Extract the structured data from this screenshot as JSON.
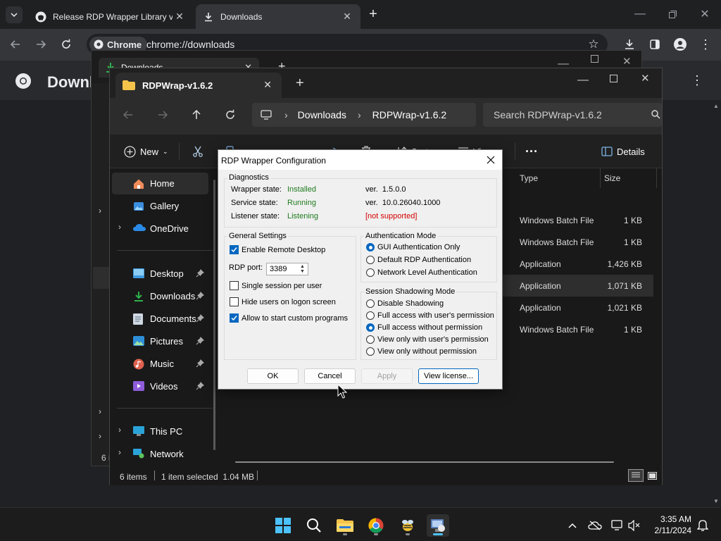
{
  "chrome": {
    "tabs": [
      {
        "title": "Release RDP Wrapper Library v",
        "icon": "github-icon"
      },
      {
        "title": "Downloads",
        "icon": "download-icon"
      }
    ],
    "url_chip": "Chrome",
    "url": "chrome://downloads",
    "page_title": "Downl"
  },
  "bg_explorer": {
    "tab_title": "Downloads",
    "status_partial": "6 i"
  },
  "explorer": {
    "tab_title": "RDPWrap-v1.6.2",
    "breadcrumb": [
      "Downloads",
      "RDPWrap-v1.6.2"
    ],
    "search_placeholder": "Search RDPWrap-v1.6.2",
    "commands": {
      "new": "New",
      "sort": "Sort",
      "view": "View",
      "details": "Details"
    },
    "sidebar": [
      {
        "label": "Home",
        "icon": "home-icon"
      },
      {
        "label": "Gallery",
        "icon": "gallery-icon"
      },
      {
        "label": "OneDrive",
        "icon": "onedrive-icon"
      },
      {
        "label": "Desktop",
        "icon": "desktop-icon"
      },
      {
        "label": "Downloads",
        "icon": "download-icon"
      },
      {
        "label": "Documents",
        "icon": "documents-icon"
      },
      {
        "label": "Pictures",
        "icon": "pictures-icon"
      },
      {
        "label": "Music",
        "icon": "music-icon"
      },
      {
        "label": "Videos",
        "icon": "videos-icon"
      },
      {
        "label": "This PC",
        "icon": "computer-icon"
      },
      {
        "label": "Network",
        "icon": "network-icon"
      }
    ],
    "columns": {
      "type": "Type",
      "size": "Size"
    },
    "rows": [
      {
        "type": "Windows Batch File",
        "size": "1 KB"
      },
      {
        "type": "Windows Batch File",
        "size": "1 KB"
      },
      {
        "type": "Application",
        "size": "1,426 KB"
      },
      {
        "type": "Application",
        "size": "1,071 KB"
      },
      {
        "type": "Application",
        "size": "1,021 KB"
      },
      {
        "type": "Windows Batch File",
        "size": "1 KB"
      }
    ],
    "status": {
      "items": "6 items",
      "selected": "1 item selected  1.04 MB"
    }
  },
  "dialog": {
    "title": "RDP Wrapper Configuration",
    "diagnostics": {
      "label": "Diagnostics",
      "wrapper_label": "Wrapper state:",
      "wrapper_value": "Installed",
      "wrapper_ver": "ver.  1.5.0.0",
      "service_label": "Service state:",
      "service_value": "Running",
      "service_ver": "ver.  10.0.26040.1000",
      "listener_label": "Listener state:",
      "listener_value": "Listening",
      "listener_ver": "[not supported]"
    },
    "general": {
      "label": "General Settings",
      "enable_remote": "Enable Remote Desktop",
      "rdp_port_label": "RDP port:",
      "rdp_port_value": "3389",
      "single_session": "Single session per user",
      "hide_users": "Hide users on logon screen",
      "allow_custom": "Allow to start custom programs"
    },
    "auth": {
      "label": "Authentication Mode",
      "options": [
        "GUI Authentication Only",
        "Default RDP Authentication",
        "Network Level Authentication"
      ]
    },
    "shadow": {
      "label": "Session Shadowing Mode",
      "options": [
        "Disable Shadowing",
        "Full access with user's permission",
        "Full access without permission",
        "View only with user's permission",
        "View only without permission"
      ]
    },
    "buttons": {
      "ok": "OK",
      "cancel": "Cancel",
      "apply": "Apply",
      "license": "View license..."
    }
  },
  "taskbar": {
    "time": "3:35 AM",
    "date": "2/11/2024"
  }
}
